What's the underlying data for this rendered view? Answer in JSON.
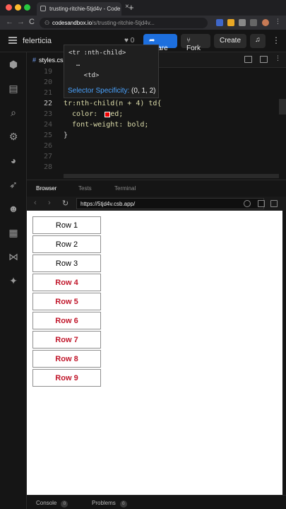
{
  "browser": {
    "tab_title": "trusting-ritchie-5tjd4v - Code",
    "tab_close": "×",
    "new_tab": "+",
    "url_host": "codesandbox.io",
    "url_path": "/s/trusting-ritchie-5tjd4v...",
    "back": "←",
    "forward": "→",
    "reload": "C"
  },
  "header": {
    "project_name": "felerticia",
    "likes": "♥ 0",
    "share_label": "➦ Share",
    "fork_label": "⑂ Fork",
    "create_label": "Create",
    "bell": "♫",
    "more": "⋮"
  },
  "editor": {
    "file_tab": "styles.css",
    "lines": [
      {
        "n": "19",
        "text": ""
      },
      {
        "n": "20",
        "text": ""
      },
      {
        "n": "21",
        "text": ""
      },
      {
        "n": "22",
        "text": "tr:nth-child(n + 4) td{"
      },
      {
        "n": "23",
        "text": "  color:  red;"
      },
      {
        "n": "24",
        "text": "  font-weight: bold;"
      },
      {
        "n": "25",
        "text": "}"
      },
      {
        "n": "26",
        "text": ""
      },
      {
        "n": "27",
        "text": ""
      },
      {
        "n": "28",
        "text": ""
      }
    ],
    "color_swatch": "#ee0000"
  },
  "tooltip": {
    "line1": "<tr :nth-child>",
    "line2": "  …",
    "line3": "    <td>",
    "spec_label": "Selector Specificity:",
    "spec_value": "(0, 1, 2)"
  },
  "preview": {
    "tabs": [
      "Browser",
      "Tests",
      "Terminal"
    ],
    "url": "https://5tjd4v.csb.app/",
    "rows": [
      {
        "label": "Row 1",
        "highlight": false
      },
      {
        "label": "Row 2",
        "highlight": false
      },
      {
        "label": "Row 3",
        "highlight": false
      },
      {
        "label": "Row 4",
        "highlight": true
      },
      {
        "label": "Row 5",
        "highlight": true
      },
      {
        "label": "Row 6",
        "highlight": true
      },
      {
        "label": "Row 7",
        "highlight": true
      },
      {
        "label": "Row 8",
        "highlight": true
      },
      {
        "label": "Row 9",
        "highlight": true
      }
    ],
    "highlight_color": "#c0162a"
  },
  "bottom": {
    "console_label": "Console",
    "console_count": "0",
    "problems_label": "Problems",
    "problems_count": "0"
  },
  "colors": {
    "accent": "#1d6fde",
    "link": "#4aa3ff"
  }
}
